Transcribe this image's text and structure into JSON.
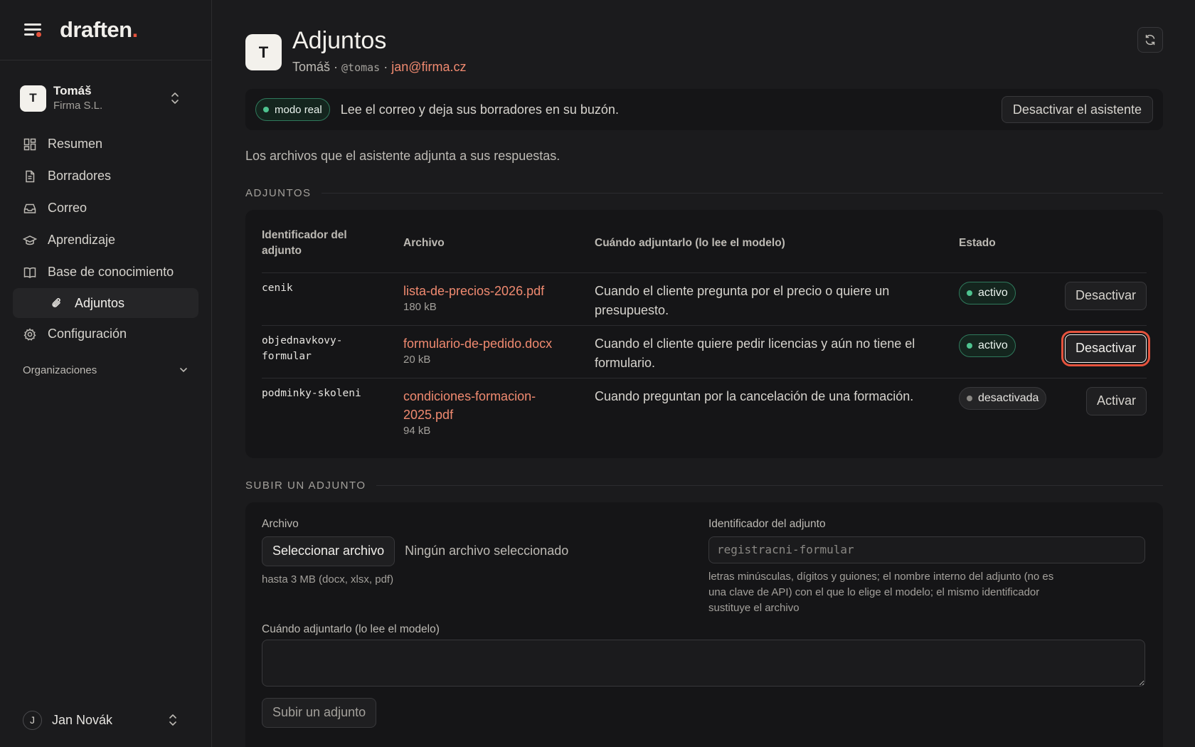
{
  "brand": {
    "name": "draften",
    "dot": "."
  },
  "account": {
    "initial": "T",
    "name": "Tomáš",
    "org": "Firma S.L."
  },
  "nav": {
    "items": [
      {
        "label": "Resumen",
        "icon": "grid-icon"
      },
      {
        "label": "Borradores",
        "icon": "document-icon"
      },
      {
        "label": "Correo",
        "icon": "inbox-icon"
      },
      {
        "label": "Aprendizaje",
        "icon": "graduation-cap-icon"
      },
      {
        "label": "Base de conocimiento",
        "icon": "book-icon"
      }
    ],
    "sub_item": {
      "label": "Adjuntos",
      "icon": "paperclip-icon"
    },
    "after": {
      "label": "Configuración",
      "icon": "gear-icon"
    },
    "section": {
      "label": "Organizaciones"
    }
  },
  "user": {
    "initial": "J",
    "name": "Jan Novák"
  },
  "header": {
    "initial": "T",
    "title": "Adjuntos",
    "name": "Tomáš",
    "sep": " · ",
    "handle": "@tomas",
    "email": "jan@firma.cz"
  },
  "banner": {
    "mode": "modo real",
    "text": "Lee el correo y deja sus borradores en su buzón.",
    "button": "Desactivar el asistente"
  },
  "intro": "Los archivos que el asistente adjunta a sus respuestas.",
  "attachments": {
    "section_title": "ADJUNTOS",
    "columns": [
      "Identificador del adjunto",
      "Archivo",
      "Cuándo adjuntarlo (lo lee el modelo)",
      "Estado"
    ],
    "rows": [
      {
        "id": "cenik",
        "file": "lista-de-precios-2026.pdf",
        "size": "180 kB",
        "when": "Cuando el cliente pregunta por el precio o quiere un presupuesto.",
        "status": "activo",
        "action": "Desactivar"
      },
      {
        "id": "objednavkovy-formular",
        "file": "formulario-de-pedido.docx",
        "size": "20 kB",
        "when": "Cuando el cliente quiere pedir licencias y aún no tiene el formulario.",
        "status": "activo",
        "action": "Desactivar"
      },
      {
        "id": "podminky-skoleni",
        "file": "condiciones-formacion-2025.pdf",
        "size": "94 kB",
        "when": "Cuando preguntan por la cancelación de una formación.",
        "status": "desactivada",
        "action": "Activar"
      }
    ]
  },
  "upload": {
    "section_title": "SUBIR UN ADJUNTO",
    "file_label": "Archivo",
    "choose_button": "Seleccionar archivo",
    "no_file": "Ningún archivo seleccionado",
    "file_hint": "hasta 3 MB (docx, xlsx, pdf)",
    "id_label": "Identificador del adjunto",
    "id_placeholder": "registracni-formular",
    "id_hint": "letras minúsculas, dígitos y guiones; el nombre interno del adjunto (no es una clave de API) con el que lo elige el modelo; el mismo identificador sustituye el archivo",
    "when_label": "Cuándo adjuntarlo (lo lee el modelo)",
    "when_value": "",
    "submit": "Subir un adjunto"
  },
  "colors": {
    "accent": "#e5533d",
    "link": "#f08a70",
    "active_green": "#4ec38f",
    "background": "#1b1b1d",
    "panel": "#151517"
  }
}
